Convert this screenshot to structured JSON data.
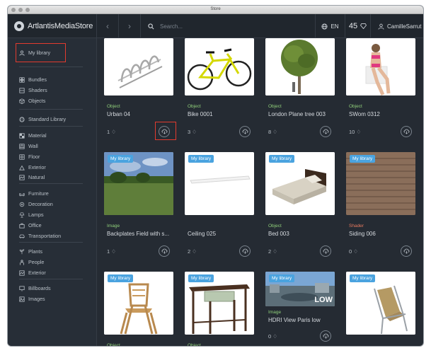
{
  "window": {
    "title": "Store"
  },
  "topbar": {
    "brand": "ArtlantisMediaStore",
    "back_icon": "chevron-left-icon",
    "forward_icon": "chevron-right-icon",
    "search_placeholder": "Search...",
    "language": "EN",
    "credits": "45",
    "username": "CamilleSarrut"
  },
  "sidebar": {
    "my_library": "My library",
    "groups": [
      [
        "Bundles",
        "Shaders",
        "Objects"
      ],
      [
        "Standard Library"
      ],
      [
        "Material",
        "Wall",
        "Floor",
        "Exterior",
        "Natural"
      ],
      [
        "Furniture",
        "Decoration",
        "Lamps",
        "Office",
        "Transportation"
      ],
      [
        "Plants",
        "People",
        "Exterior"
      ],
      [
        "Billboards",
        "Images"
      ]
    ]
  },
  "colors": {
    "accent": "#4aa3df",
    "object_type": "#8fcf7a",
    "shader_type": "#e87a5f",
    "highlight": "#e23b2e"
  },
  "cards": [
    {
      "badge": "",
      "type": "Object",
      "name": "Urban 04",
      "count": "1"
    },
    {
      "badge": "",
      "type": "Object",
      "name": "Bike 0001",
      "count": "3"
    },
    {
      "badge": "",
      "type": "Object",
      "name": "London Plane tree 003",
      "count": "8"
    },
    {
      "badge": "",
      "type": "Object",
      "name": "SWom 0312",
      "count": "10"
    },
    {
      "badge": "My library",
      "type": "Image",
      "name": "Backplates Field with s...",
      "count": "1"
    },
    {
      "badge": "My library",
      "type": "",
      "name": "Ceiling 025",
      "count": "2"
    },
    {
      "badge": "My library",
      "type": "Object",
      "name": "Bed 003",
      "count": "2"
    },
    {
      "badge": "My library",
      "type": "Shader",
      "name": "Siding 006",
      "count": "0"
    },
    {
      "badge": "My library",
      "type": "Object",
      "name": "",
      "count": ""
    },
    {
      "badge": "My library",
      "type": "Object",
      "name": "",
      "count": ""
    },
    {
      "badge": "My library",
      "type": "Image",
      "name": "HDRI View Paris low",
      "count": "0",
      "overlay": "LOW"
    },
    {
      "badge": "My library",
      "type": "",
      "name": "",
      "count": ""
    }
  ]
}
